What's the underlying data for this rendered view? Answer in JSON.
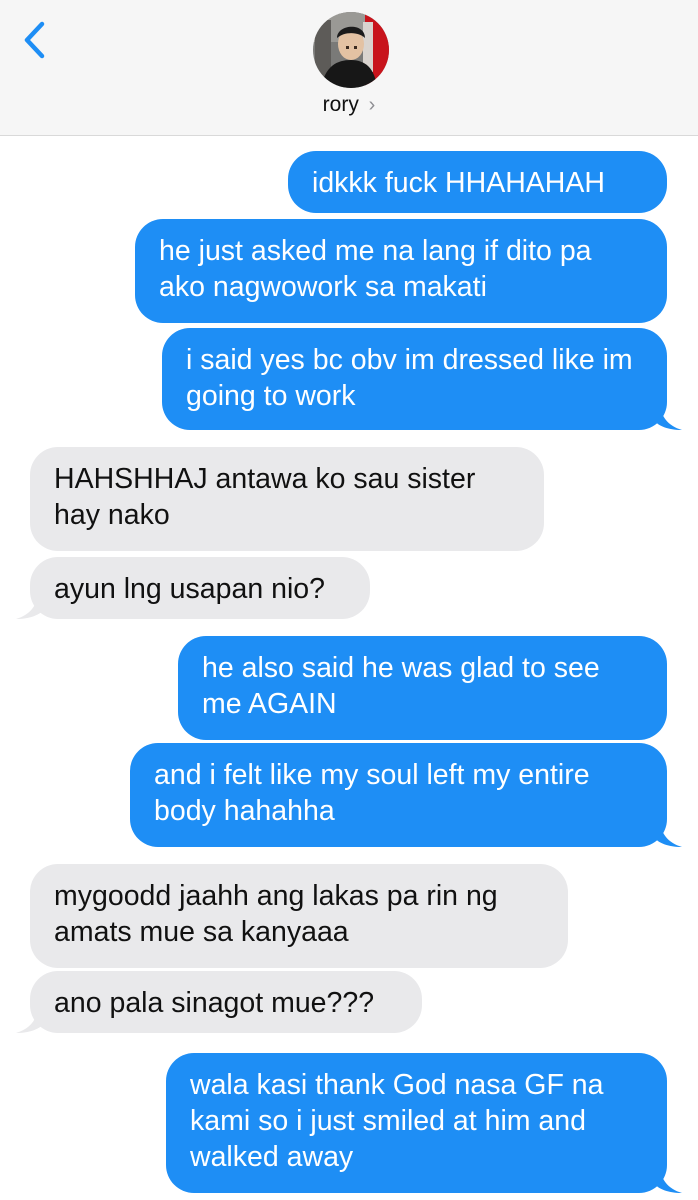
{
  "header": {
    "contact_name": "rory",
    "contact_chevron": "›",
    "back_icon": "chevron-left-icon",
    "accent_color": "#1e8ef5"
  },
  "messages": [
    {
      "from": "me",
      "text": "idkkk fuck HHAHAHAH"
    },
    {
      "from": "me",
      "text": "he just asked me na lang if dito pa ako nagwowork sa makati"
    },
    {
      "from": "me",
      "text": "i said yes bc obv im dressed like im going to work"
    },
    {
      "from": "them",
      "text": "HAHSHHAJ antawa ko sau sister hay nako"
    },
    {
      "from": "them",
      "text": "ayun lng usapan nio?"
    },
    {
      "from": "me",
      "text": "he also said he was glad to see me AGAIN"
    },
    {
      "from": "me",
      "text": "and i felt like my soul left my entire body hahahha"
    },
    {
      "from": "them",
      "text": "mygoodd jaahh ang lakas pa rin ng amats mue sa kanyaaa"
    },
    {
      "from": "them",
      "text": "ano pala sinagot mue???"
    },
    {
      "from": "me",
      "text": "wala kasi thank God nasa GF na kami so i just smiled at him and walked away"
    }
  ]
}
